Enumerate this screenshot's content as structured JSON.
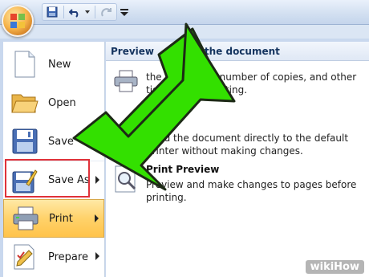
{
  "quick_access": {
    "icons": [
      "save-icon",
      "undo-icon",
      "redo-icon",
      "customize-dropdown-icon"
    ]
  },
  "menu": {
    "items": [
      {
        "label": "New",
        "icon": "new-document-icon"
      },
      {
        "label": "Open",
        "icon": "open-folder-icon"
      },
      {
        "label": "Save",
        "icon": "floppy-disk-icon"
      },
      {
        "label": "Save As",
        "icon": "save-as-icon",
        "has_submenu": true
      },
      {
        "label": "Print",
        "icon": "printer-icon",
        "has_submenu": true,
        "selected": true
      },
      {
        "label": "Prepare",
        "icon": "prepare-icon",
        "has_submenu": true
      }
    ]
  },
  "print_panel": {
    "header_left": "Preview",
    "header_right": "rint the document",
    "options": [
      {
        "title": "",
        "desc_line1": "the document, number of copies, and other",
        "desc_line2": "tions before printing.",
        "icon": "printer-icon"
      },
      {
        "title": "",
        "desc_line1": "Send the document directly to the default",
        "desc_line2": "printer without making changes.",
        "icon": "quick-print-icon"
      },
      {
        "title": "Print Preview",
        "desc_line1": "Preview and make changes to pages before",
        "desc_line2": "printing.",
        "icon": "print-preview-magnifier-icon"
      }
    ]
  },
  "annotation": {
    "arrow_color": "#33e000",
    "highlight_color": "#e0323a"
  },
  "watermark": {
    "text": "wikiHow"
  }
}
